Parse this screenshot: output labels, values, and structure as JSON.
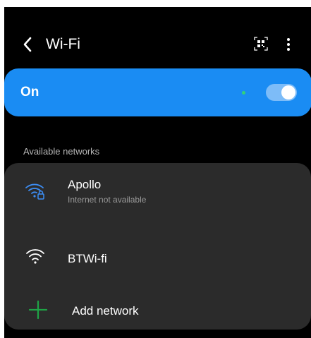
{
  "header": {
    "title": "Wi-Fi",
    "back_icon": "chevron-left-icon",
    "qr_icon": "qr-code-scan-icon",
    "more_icon": "more-vertical-icon"
  },
  "wifi_toggle": {
    "label": "On",
    "enabled": true,
    "accent_color": "#1a8cf3"
  },
  "section": {
    "title": "Available networks"
  },
  "networks": [
    {
      "name": "Apollo",
      "status": "Internet not available",
      "icon": "wifi-locked-icon",
      "connected": true,
      "color": "#3d8ef5"
    },
    {
      "name": "BTWi-fi",
      "icon": "wifi-icon",
      "color": "#ffffff"
    }
  ],
  "add_network": {
    "label": "Add network",
    "icon": "plus-icon",
    "color": "#1ea446"
  }
}
